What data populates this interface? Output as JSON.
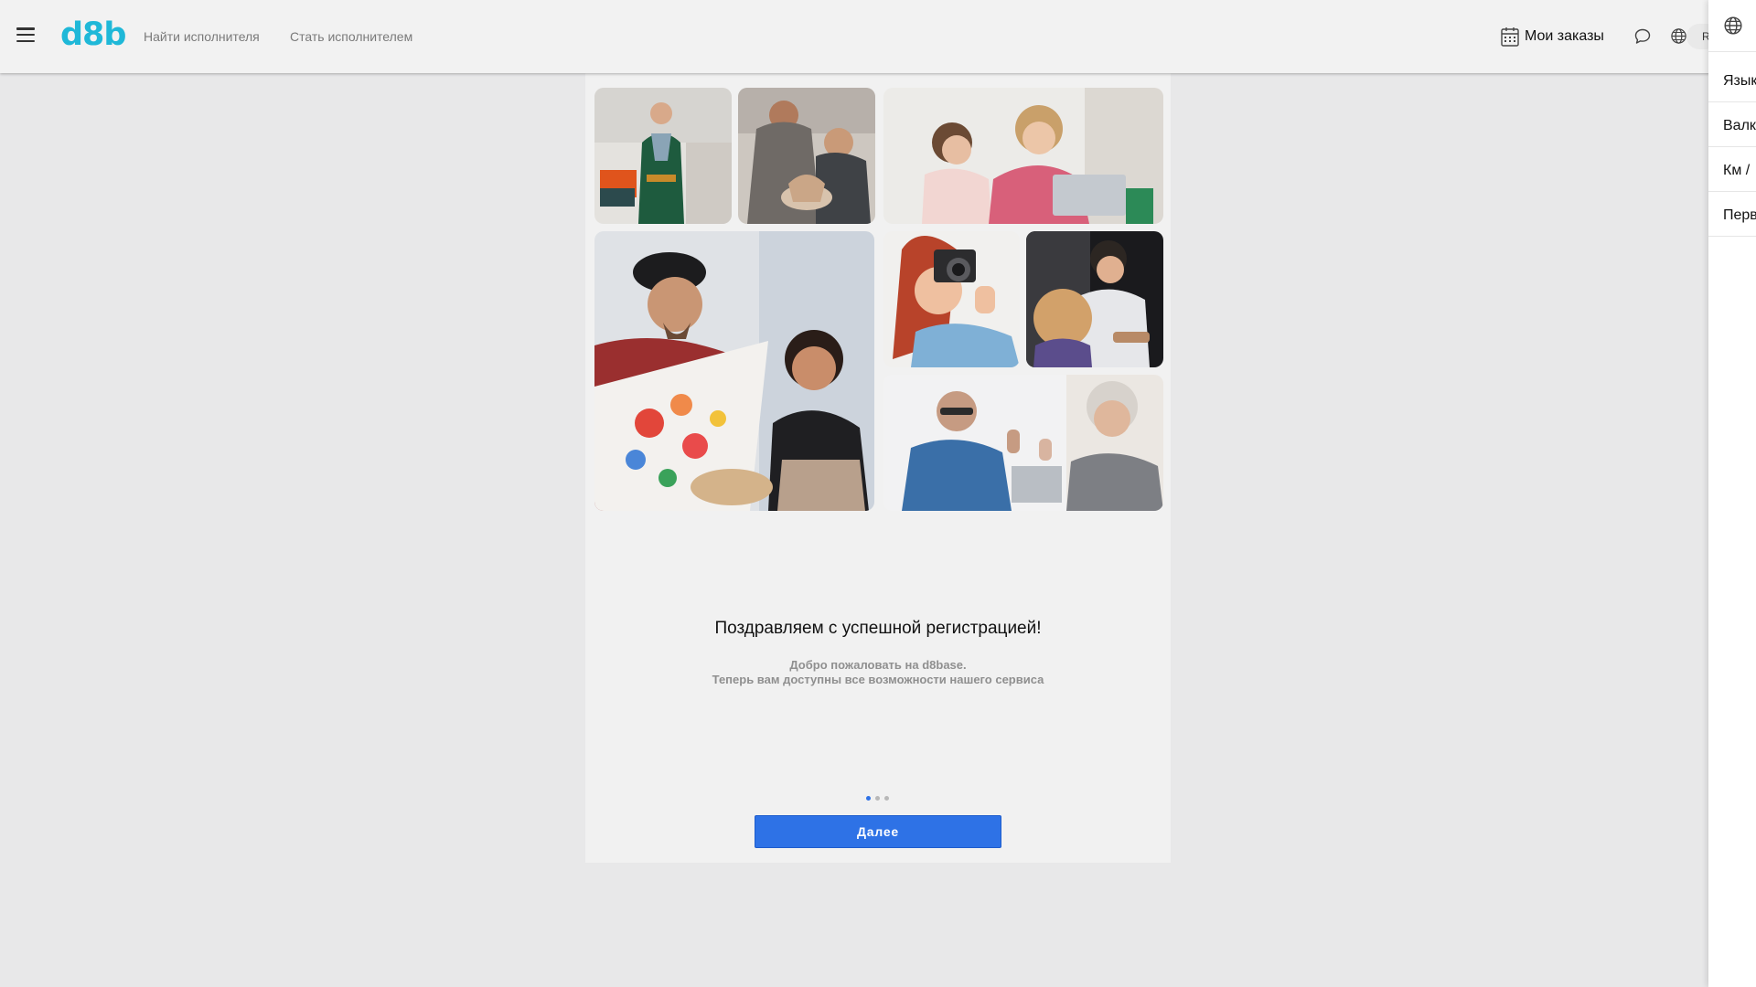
{
  "header": {
    "logo": "d8b",
    "nav": {
      "find_performer": "Найти исполнителя",
      "become_performer": "Стать исполнителем"
    },
    "my_orders": "Мои заказы",
    "lang_code": "R"
  },
  "gallery": {
    "tiles": [
      "plumber-photo",
      "pottery-photo",
      "tutoring-photo",
      "painting-photo",
      "photographer-photo",
      "hairdresser-photo",
      "doctor-photo"
    ]
  },
  "welcome": {
    "title": "Поздравляем с успешной регистрацией!",
    "line1": "Добро пожаловать на d8base.",
    "line2": "Теперь вам доступны все возможности нашего сервиса"
  },
  "pagination": {
    "total": 3,
    "active": 1
  },
  "next_button": "Далее",
  "side_panel": {
    "items": [
      "Язык",
      "Валк",
      "Км /",
      "Перв"
    ]
  },
  "colors": {
    "brand": "#1fb8d8",
    "primary": "#2e72e6",
    "header_bg": "#f2f2f2",
    "page_bg": "#e8e8e9"
  }
}
